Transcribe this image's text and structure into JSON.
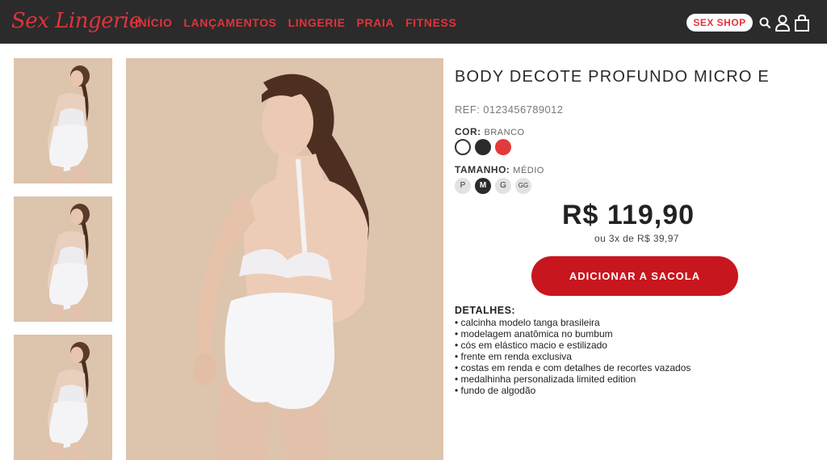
{
  "header": {
    "logo": "Sex Lingerie",
    "nav": [
      "INÍCIO",
      "LANÇAMENTOS",
      "LINGERIE",
      "PRAIA",
      "FITNESS"
    ],
    "sex_shop": "SEX SHOP",
    "icons": [
      "search-icon",
      "user-icon",
      "bag-icon"
    ],
    "accent_color": "#e0343a",
    "bg_color": "#2b2b2b"
  },
  "gallery": {
    "thumbnails": 3,
    "image_alt": "Body branco decote profundo, vista de costas"
  },
  "product": {
    "name": "BODY DECOTE PROFUNDO MICRO E",
    "ref": "REF: 0123456789012",
    "color_label": "COR:",
    "color_value": "BRANCO",
    "colors": [
      {
        "name": "branco",
        "hex": "#ffffff",
        "selected": true
      },
      {
        "name": "preto",
        "hex": "#2b2b2b",
        "selected": false
      },
      {
        "name": "vermelho",
        "hex": "#e23a3a",
        "selected": false
      }
    ],
    "size_label": "TAMANHO:",
    "size_value": "MÉDIO",
    "sizes": [
      {
        "label": "P",
        "selected": false
      },
      {
        "label": "M",
        "selected": true
      },
      {
        "label": "G",
        "selected": false
      },
      {
        "label": "GG",
        "selected": false
      }
    ],
    "price": "R$ 119,90",
    "installments": "ou 3x de R$ 39,97",
    "add_button": "ADICIONAR A SACOLA",
    "button_color": "#c8161e"
  },
  "details": {
    "title": "DETALHES:",
    "items": [
      "calcinha modelo tanga brasileira",
      "modelagem anatômica no bumbum",
      "cós em elástico macio e estilizado",
      "frente em renda exclusiva",
      "costas em renda e com detalhes de recortes vazados",
      "medalhinha personalizada limited edition",
      "fundo de algodão"
    ]
  }
}
